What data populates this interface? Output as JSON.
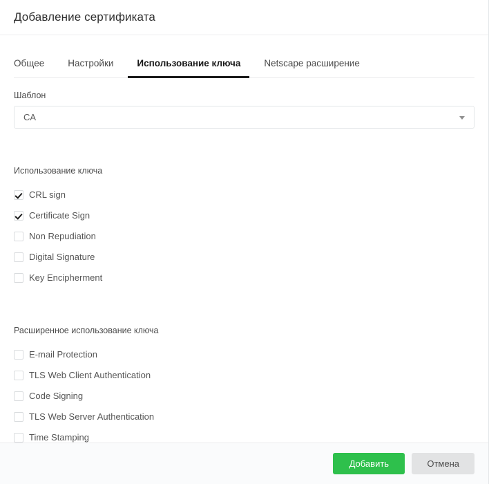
{
  "dialog": {
    "title": "Добавление сертификата"
  },
  "tabs": [
    {
      "label": "Общее",
      "active": false
    },
    {
      "label": "Настройки",
      "active": false
    },
    {
      "label": "Использование ключа",
      "active": true
    },
    {
      "label": "Netscape расширение",
      "active": false
    }
  ],
  "template_field": {
    "label": "Шаблон",
    "value": "CA",
    "caret_icon": "chevron-down-icon"
  },
  "key_usage": {
    "title": "Использование ключа",
    "items": [
      {
        "label": "CRL sign",
        "checked": true
      },
      {
        "label": "Certificate Sign",
        "checked": true
      },
      {
        "label": "Non Repudiation",
        "checked": false
      },
      {
        "label": "Digital Signature",
        "checked": false
      },
      {
        "label": "Key Encipherment",
        "checked": false
      }
    ]
  },
  "extended_key_usage": {
    "title": "Расширенное использование ключа",
    "items": [
      {
        "label": "E-mail Protection",
        "checked": false
      },
      {
        "label": "TLS Web Client Authentication",
        "checked": false
      },
      {
        "label": "Code Signing",
        "checked": false
      },
      {
        "label": "TLS Web Server Authentication",
        "checked": false
      },
      {
        "label": "Time Stamping",
        "checked": false
      }
    ]
  },
  "footer": {
    "submit_label": "Добавить",
    "cancel_label": "Отмена"
  },
  "colors": {
    "accent_green": "#2ec04c",
    "cancel_gray": "#e2e3e4",
    "active_tab_underline": "#1a1a1a",
    "border": "#ececee"
  }
}
